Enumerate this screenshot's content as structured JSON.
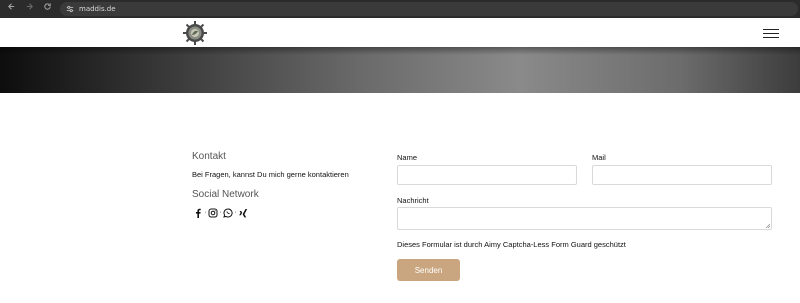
{
  "browser": {
    "url": "maddis.de",
    "back_icon": "arrow-left-icon",
    "forward_icon": "arrow-right-icon",
    "reload_icon": "reload-icon",
    "site_info_icon": "tune-icon"
  },
  "header": {
    "logo_icon": "gear-emblem-logo",
    "menu_icon": "hamburger-menu-icon"
  },
  "contact": {
    "title": "Kontakt",
    "text": "Bei Fragen, kannst Du mich gerne kontaktieren",
    "social_title": "Social Network",
    "social_icons": [
      "facebook-icon",
      "instagram-icon",
      "whatsapp-icon",
      "xing-icon"
    ],
    "separator": "·"
  },
  "form": {
    "name_label": "Name",
    "name_value": "",
    "mail_label": "Mail",
    "mail_value": "",
    "message_label": "Nachricht",
    "message_value": "",
    "notice_prefix": "Dieses Formular ist durch ",
    "notice_link": "Aimy Captcha-Less Form Guard",
    "notice_suffix": " geschützt",
    "submit_label": "Senden",
    "submit_color": "#c9a67f"
  }
}
